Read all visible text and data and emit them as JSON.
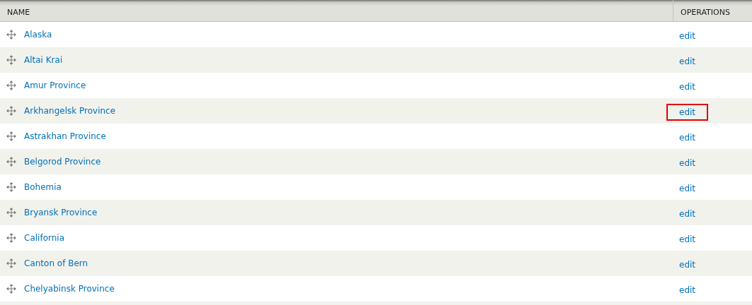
{
  "table": {
    "columns": [
      "NAME",
      "OPERATIONS"
    ],
    "rows": [
      {
        "name": "Alaska",
        "operation": "edit",
        "highlighted": false
      },
      {
        "name": "Altai Krai",
        "operation": "edit",
        "highlighted": false
      },
      {
        "name": "Amur Province",
        "operation": "edit",
        "highlighted": false
      },
      {
        "name": "Arkhangelsk Province",
        "operation": "edit",
        "highlighted": true
      },
      {
        "name": "Astrakhan Province",
        "operation": "edit",
        "highlighted": false
      },
      {
        "name": "Belgorod Province",
        "operation": "edit",
        "highlighted": false
      },
      {
        "name": "Bohemia",
        "operation": "edit",
        "highlighted": false
      },
      {
        "name": "Bryansk Province",
        "operation": "edit",
        "highlighted": false
      },
      {
        "name": "California",
        "operation": "edit",
        "highlighted": false
      },
      {
        "name": "Canton of Bern",
        "operation": "edit",
        "highlighted": false
      },
      {
        "name": "Chelyabinsk Province",
        "operation": "edit",
        "highlighted": false
      }
    ]
  }
}
